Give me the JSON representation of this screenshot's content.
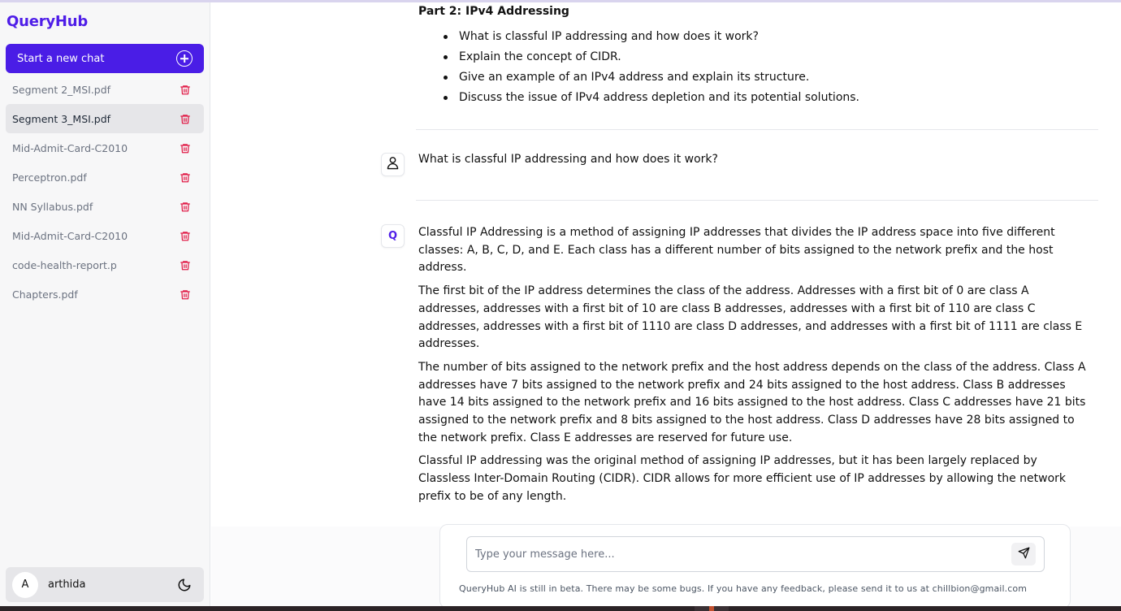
{
  "app": {
    "brand": "QueryHub"
  },
  "sidebar": {
    "new_chat_label": "Start a new chat",
    "files": [
      {
        "name": "Segment 2_MSI.pdf",
        "active": false
      },
      {
        "name": "Segment 3_MSI.pdf",
        "active": true
      },
      {
        "name": "Mid-Admit-Card-C2010",
        "active": false
      },
      {
        "name": "Perceptron.pdf",
        "active": false
      },
      {
        "name": "NN Syllabus.pdf",
        "active": false
      },
      {
        "name": "Mid-Admit-Card-C2010",
        "active": false
      },
      {
        "name": "code-health-report.p",
        "active": false
      },
      {
        "name": "Chapters.pdf",
        "active": false
      }
    ],
    "user": {
      "initial": "A",
      "name": "arthida"
    }
  },
  "chat": {
    "prev_answer": {
      "title": "Part 2: IPv4 Addressing",
      "bullets": [
        "What is classful IP addressing and how does it work?",
        "Explain the concept of CIDR.",
        "Give an example of an IPv4 address and explain its structure.",
        "Discuss the issue of IPv4 address depletion and its potential solutions."
      ]
    },
    "user_message": "What is classful IP addressing and how does it work?",
    "bot_icon_letter": "Q",
    "answer_paragraphs": [
      "Classful IP Addressing is a method of assigning IP addresses that divides the IP address space into five different classes: A, B, C, D, and E. Each class has a different number of bits assigned to the network prefix and the host address.",
      "The first bit of the IP address determines the class of the address. Addresses with a first bit of 0 are class A addresses, addresses with a first bit of 10 are class B addresses, addresses with a first bit of 110 are class C addresses, addresses with a first bit of 1110 are class D addresses, and addresses with a first bit of 1111 are class E addresses.",
      "The number of bits assigned to the network prefix and the host address depends on the class of the address. Class A addresses have 7 bits assigned to the network prefix and 24 bits assigned to the host address. Class B addresses have 14 bits assigned to the network prefix and 16 bits assigned to the host address. Class C addresses have 21 bits assigned to the network prefix and 8 bits assigned to the host address. Class D addresses have 28 bits assigned to the network prefix. Class E addresses are reserved for future use.",
      "Classful IP addressing was the original method of assigning IP addresses, but it has been largely replaced by Classless Inter-Domain Routing (CIDR). CIDR allows for more efficient use of IP addresses by allowing the network prefix to be of any length."
    ]
  },
  "composer": {
    "placeholder": "Type your message here...",
    "disclaimer": "QueryHub AI is still in beta. There may be some bugs. If you have any feedback, please send it to us at chillbion@gmail.com"
  },
  "colors": {
    "brand": "#4f1ee8",
    "button": "#4a1de6",
    "trash": "#e11d48"
  },
  "icons": [
    "plus-circle-icon",
    "trash-icon",
    "moon-icon",
    "user-icon",
    "send-icon"
  ]
}
